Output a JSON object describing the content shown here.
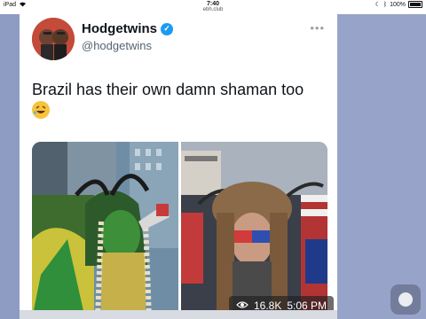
{
  "status_bar": {
    "device": "iPad",
    "time": "7:40",
    "url": "ebh.club",
    "battery": "100%"
  },
  "tweet": {
    "display_name": "Hodgetwins",
    "handle": "@hodgetwins",
    "more_label": "•••",
    "text": "Brazil has their own damn shaman too",
    "emoji": "rolling-on-floor-laughing"
  },
  "media_overlay": {
    "views": "16.8K",
    "time": "5:06 PM"
  },
  "colors": {
    "verified": "#1d9bf0",
    "side_background": "#8e9cc4"
  }
}
